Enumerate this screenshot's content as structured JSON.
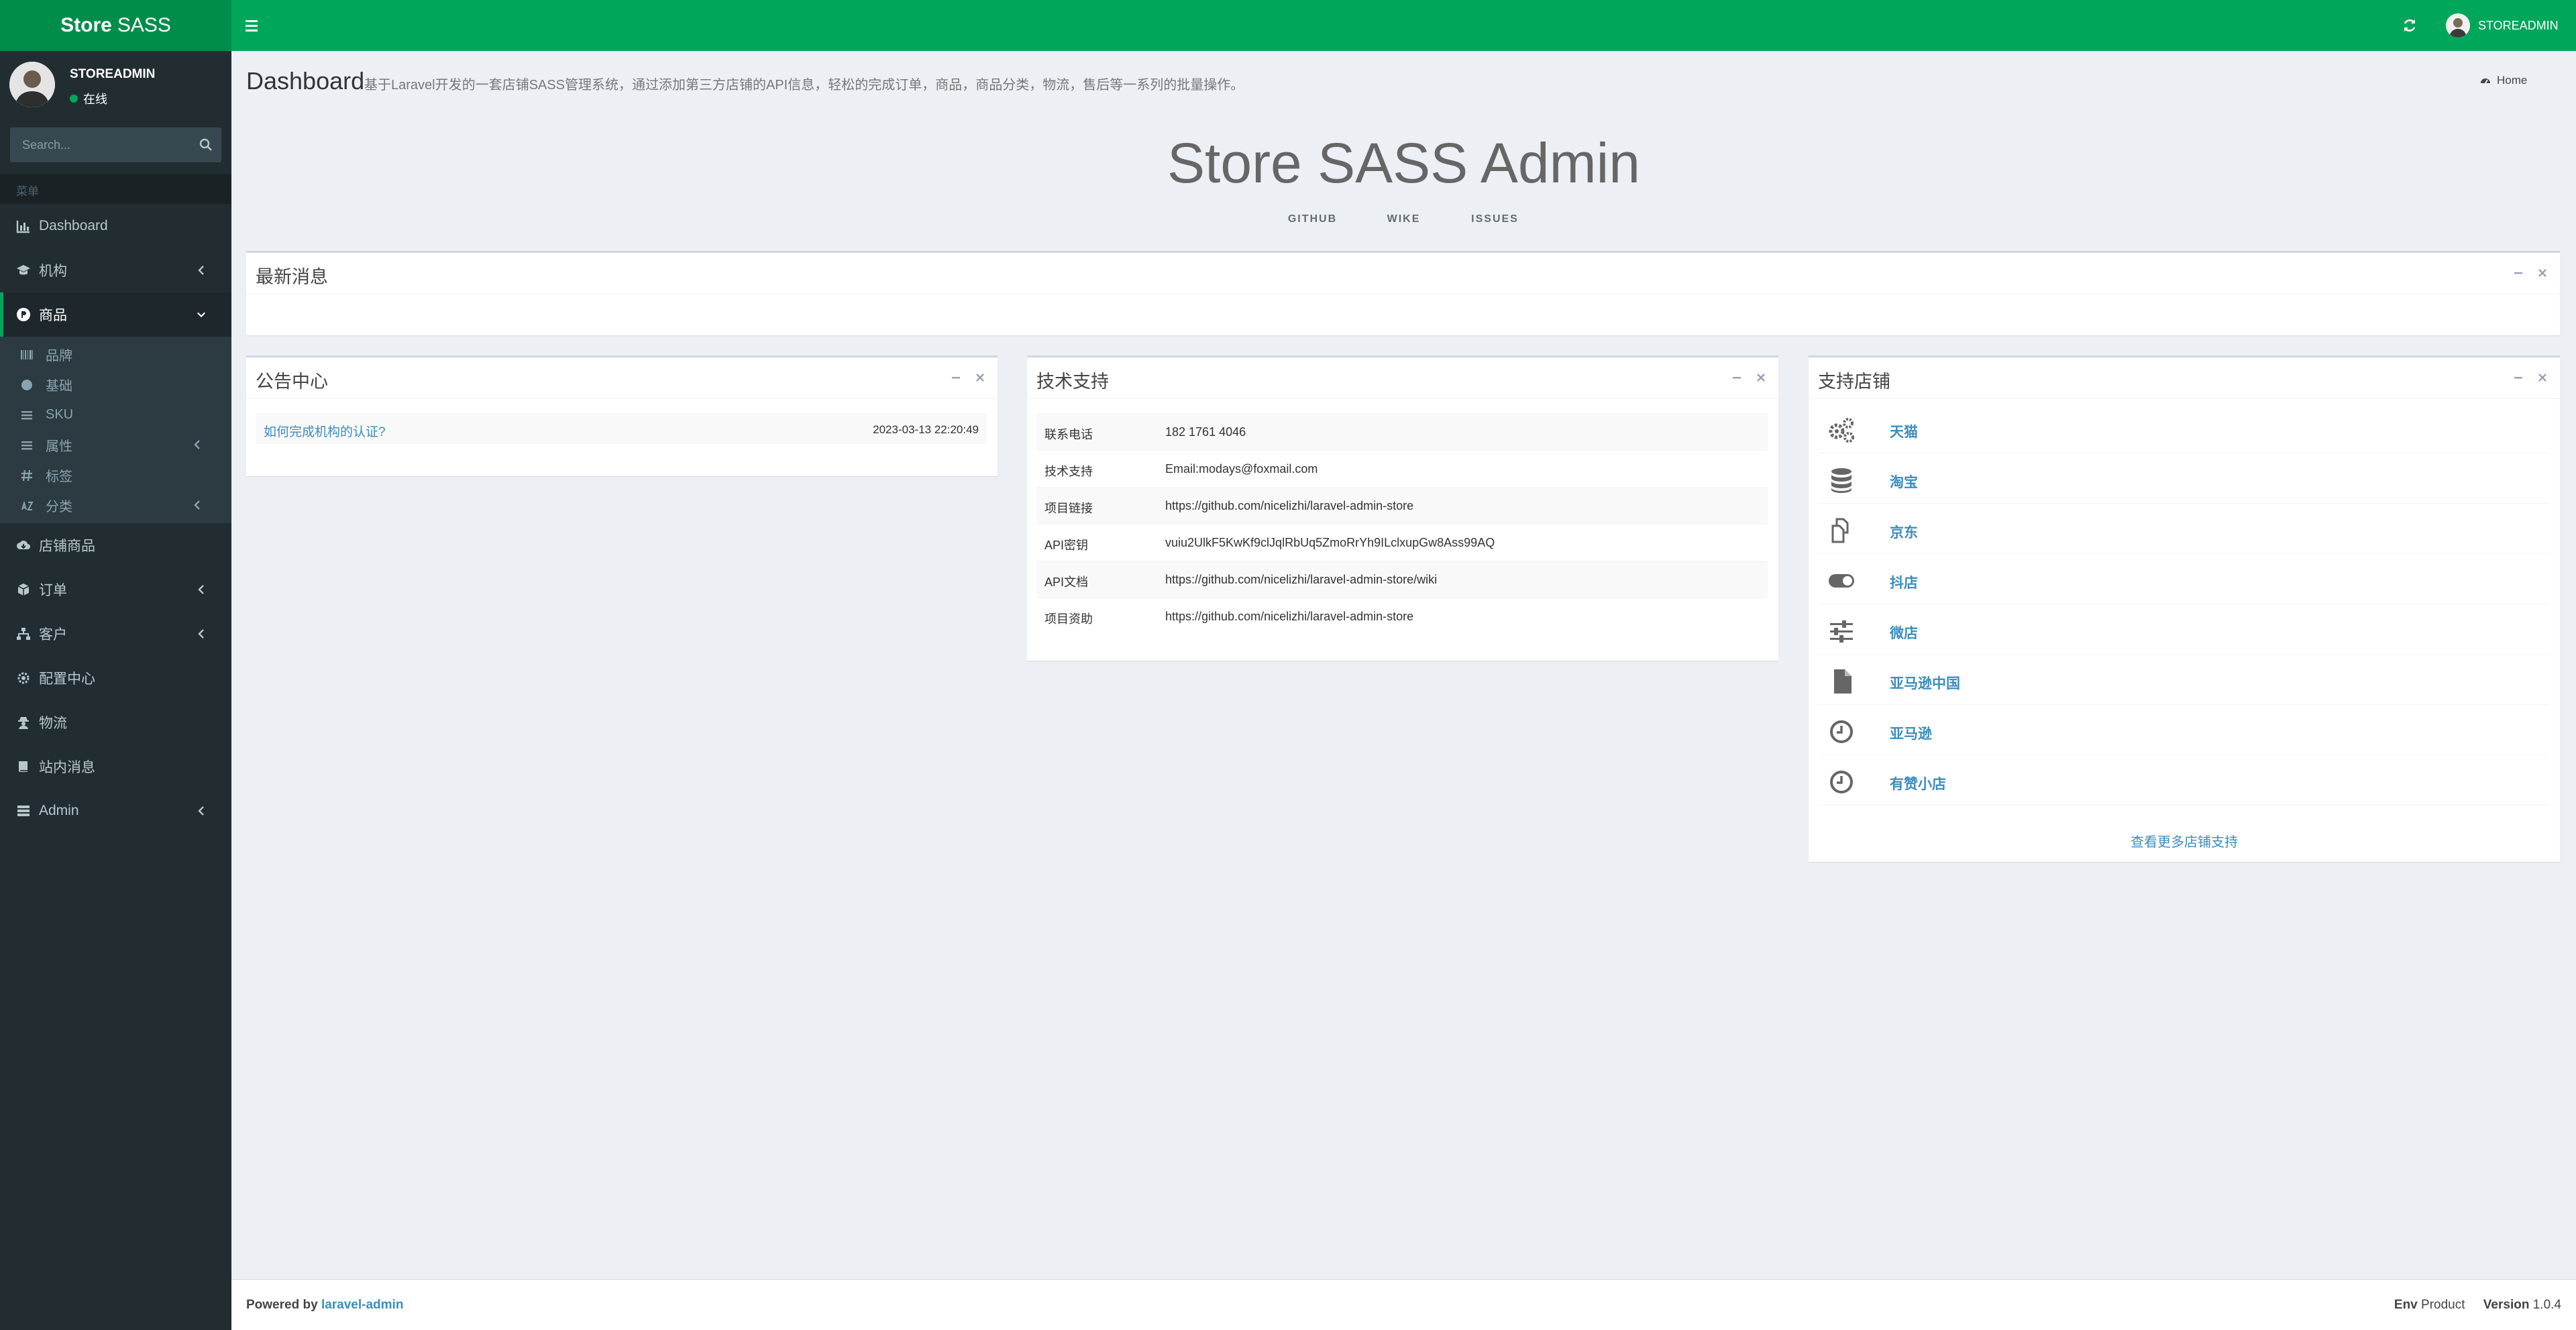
{
  "brand": {
    "name_bold": "Store",
    "name_thin": "SASS"
  },
  "header": {
    "user": "STOREADMIN"
  },
  "sidebar": {
    "user_name": "STOREADMIN",
    "status": "在线",
    "search_placeholder": "Search...",
    "menu_header": "菜单",
    "items": [
      {
        "label": "Dashboard"
      },
      {
        "label": "机构"
      },
      {
        "label": "商品"
      },
      {
        "label": "店铺商品"
      },
      {
        "label": "订单"
      },
      {
        "label": "客户"
      },
      {
        "label": "配置中心"
      },
      {
        "label": "物流"
      },
      {
        "label": "站内消息"
      },
      {
        "label": "Admin"
      }
    ],
    "sub_items": [
      {
        "label": "品牌"
      },
      {
        "label": "基础"
      },
      {
        "label": "SKU"
      },
      {
        "label": "属性"
      },
      {
        "label": "标签"
      },
      {
        "label": "分类"
      }
    ]
  },
  "page": {
    "title": "Dashboard",
    "subtitle": "基于Laravel开发的一套店铺SASS管理系统，通过添加第三方店铺的API信息，轻松的完成订单，商品，商品分类，物流，售后等一系列的批量操作。",
    "breadcrumb": "Home",
    "hero_title": "Store SASS Admin",
    "hero_links": [
      "GITHUB",
      "WIKE",
      "ISSUES"
    ]
  },
  "boxes": {
    "news_title": "最新消息",
    "notice_title": "公告中心",
    "tech_title": "技术支持",
    "shops_title": "支持店铺"
  },
  "notices": [
    {
      "title": "如何完成机构的认证?",
      "date": "2023-03-13 22:20:49"
    }
  ],
  "tech": [
    {
      "k": "联系电话",
      "v": "182 1761 4046"
    },
    {
      "k": "技术支持",
      "v": "Email:modays@foxmail.com"
    },
    {
      "k": "项目链接",
      "v": "https://github.com/nicelizhi/laravel-admin-store"
    },
    {
      "k": "API密钥",
      "v": "vuiu2UlkF5KwKf9clJqlRbUq5ZmoRrYh9ILclxupGw8Ass99AQ"
    },
    {
      "k": "API文档",
      "v": "https://github.com/nicelizhi/laravel-admin-store/wiki"
    },
    {
      "k": "项目资助",
      "v": "https://github.com/nicelizhi/laravel-admin-store"
    }
  ],
  "shops": [
    {
      "name": "天猫",
      "icon": "gears-icon"
    },
    {
      "name": "淘宝",
      "icon": "database-icon"
    },
    {
      "name": "京东",
      "icon": "copy-icon"
    },
    {
      "name": "抖店",
      "icon": "toggle-icon"
    },
    {
      "name": "微店",
      "icon": "sliders-icon"
    },
    {
      "name": "亚马逊中国",
      "icon": "file-icon"
    },
    {
      "name": "亚马逊",
      "icon": "clock-icon"
    },
    {
      "name": "有赞小店",
      "icon": "clock-icon"
    }
  ],
  "shops_more": "查看更多店铺支持",
  "footer": {
    "powered_label": "Powered by",
    "powered_link": "laravel-admin",
    "env_label": "Env",
    "env_value": "Product",
    "version_label": "Version",
    "version_value": "1.0.4"
  },
  "colors": {
    "brand": "#00a65a",
    "brand_dark": "#008d4c",
    "sidebar": "#222d32",
    "link": "#3c8dbc"
  }
}
